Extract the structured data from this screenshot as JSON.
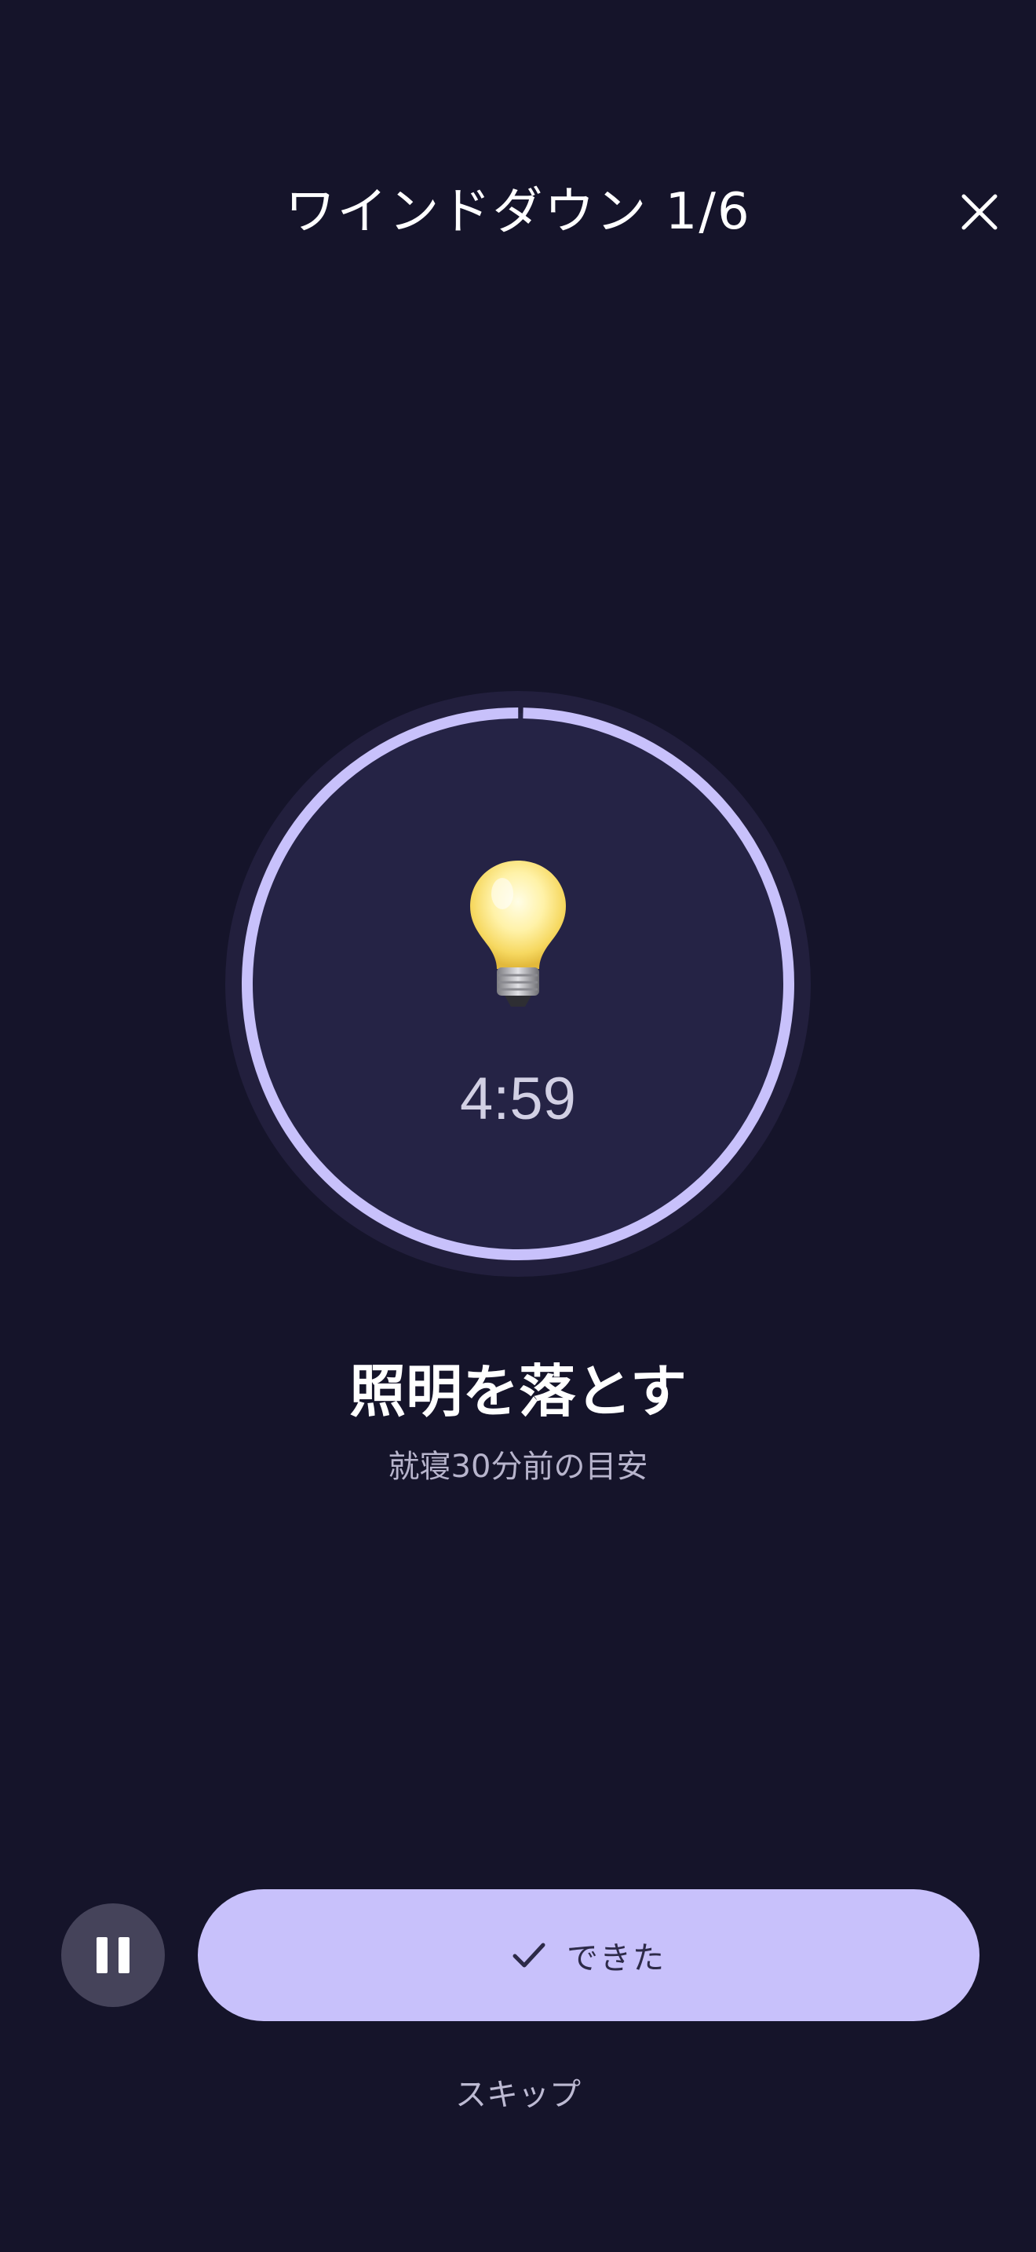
{
  "header": {
    "title": "ワインドダウン 1/6",
    "close_icon": "close-icon"
  },
  "timer": {
    "icon": "light-bulb-icon",
    "remaining": "4:59",
    "progress_fraction": 0.003
  },
  "step": {
    "title": "照明を落とす",
    "subtitle": "就寝30分前の目安"
  },
  "controls": {
    "pause_icon": "pause-icon",
    "done_icon": "checkmark-icon",
    "done_label": "できた",
    "skip_label": "スキップ"
  },
  "colors": {
    "background": "#15142a",
    "circle_fill": "#252345",
    "ring_outer": "#221f3d",
    "ring_accent": "#c8c1fb",
    "pause_button": "#45435a",
    "done_button": "#c8c1fb"
  }
}
